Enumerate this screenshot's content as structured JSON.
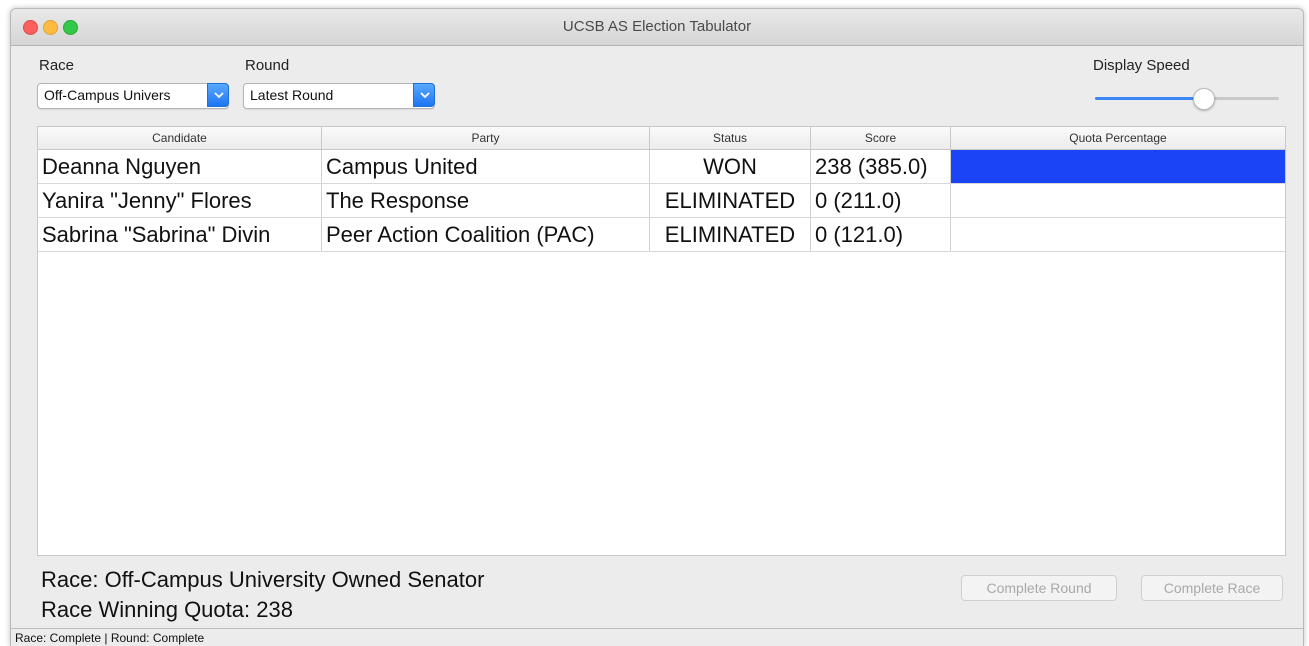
{
  "window": {
    "title": "UCSB AS Election Tabulator"
  },
  "controls": {
    "race_label": "Race",
    "race_value": "Off-Campus Univers",
    "round_label": "Round",
    "round_value": "Latest Round",
    "display_speed_label": "Display Speed",
    "display_speed_level": 0.6
  },
  "colors": {
    "accent": "#1a44f5",
    "slider_fill": "#3b87f5"
  },
  "table": {
    "columns": [
      "Candidate",
      "Party",
      "Status",
      "Score",
      "Quota Percentage"
    ],
    "rows": [
      {
        "candidate": "Deanna Nguyen",
        "party": "Campus United",
        "status": "WON",
        "score": "238 (385.0)",
        "quota_fraction": 1.0
      },
      {
        "candidate": "Yanira \"Jenny\" Flores",
        "party": "The Response",
        "status": "ELIMINATED",
        "score": "0 (211.0)",
        "quota_fraction": 0
      },
      {
        "candidate": "Sabrina \"Sabrina\" Divin",
        "party": "Peer Action Coalition (PAC)",
        "status": "ELIMINATED",
        "score": "0 (121.0)",
        "quota_fraction": 0
      }
    ]
  },
  "footer": {
    "race_line": "Race: Off-Campus University Owned Senator",
    "quota_line": "Race Winning Quota: 238",
    "complete_round_label": "Complete Round",
    "complete_race_label": "Complete Race"
  },
  "statusbar": {
    "text": "Race: Complete | Round: Complete"
  }
}
